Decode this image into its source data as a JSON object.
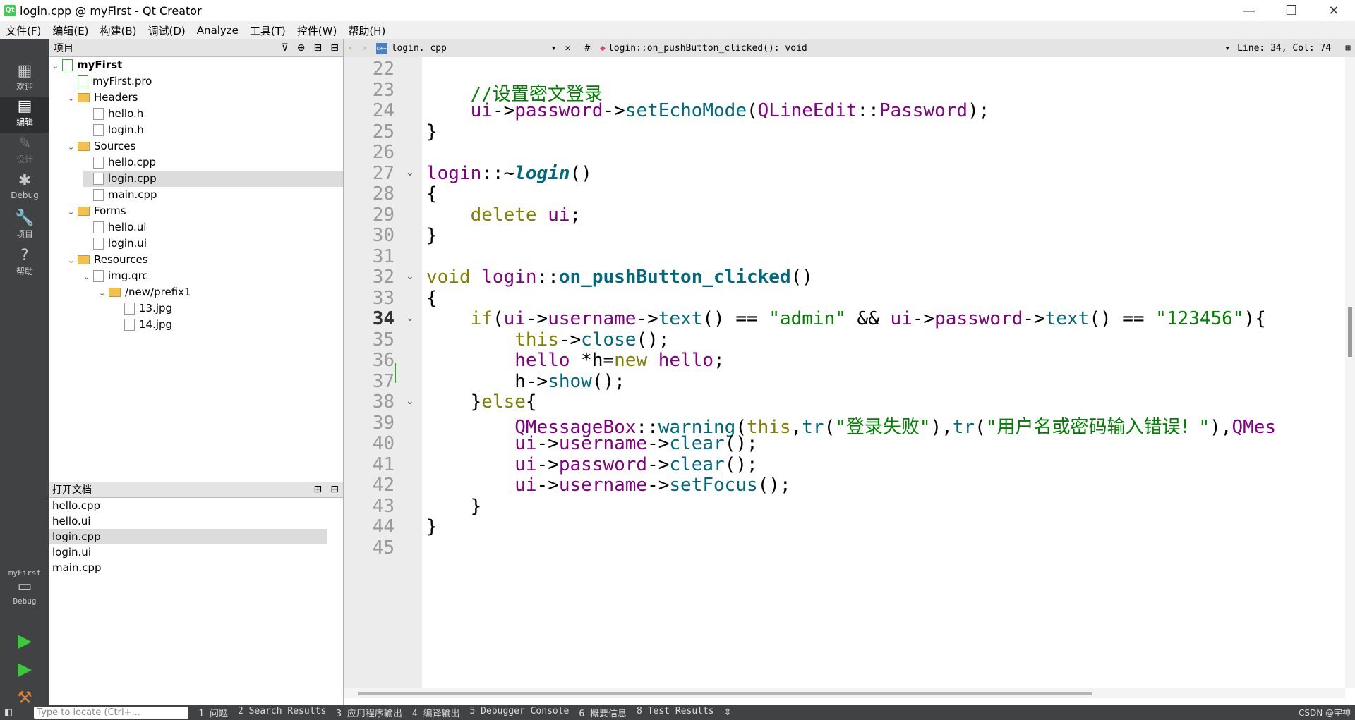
{
  "window": {
    "title": "login.cpp @ myFirst - Qt Creator",
    "minimize": "—",
    "restore": "❐",
    "close": "✕"
  },
  "menu": [
    "文件(F)",
    "编辑(E)",
    "构建(B)",
    "调试(D)",
    "Analyze",
    "工具(T)",
    "控件(W)",
    "帮助(H)"
  ],
  "modes": [
    {
      "label": "欢迎",
      "icon": "▦"
    },
    {
      "label": "编辑",
      "icon": "▤"
    },
    {
      "label": "设计",
      "icon": "✎"
    },
    {
      "label": "Debug",
      "icon": "✱"
    },
    {
      "label": "项目",
      "icon": "🔧"
    },
    {
      "label": "帮助",
      "icon": "?"
    }
  ],
  "kit": {
    "project": "myFirst",
    "config": "Debug"
  },
  "project_panel": {
    "title": "项目"
  },
  "tree": [
    {
      "label": "myFirst",
      "depth": 0,
      "arrow": "⌄",
      "kind": "proj"
    },
    {
      "label": "myFirst.pro",
      "depth": 1,
      "arrow": "",
      "kind": "proj"
    },
    {
      "label": "Headers",
      "depth": 1,
      "arrow": "⌄",
      "kind": "folder"
    },
    {
      "label": "hello.h",
      "depth": 2,
      "arrow": "",
      "kind": "h"
    },
    {
      "label": "login.h",
      "depth": 2,
      "arrow": "",
      "kind": "h"
    },
    {
      "label": "Sources",
      "depth": 1,
      "arrow": "⌄",
      "kind": "folder"
    },
    {
      "label": "hello.cpp",
      "depth": 2,
      "arrow": "",
      "kind": "cpp"
    },
    {
      "label": "login.cpp",
      "depth": 2,
      "arrow": "",
      "kind": "cpp",
      "selected": true
    },
    {
      "label": "main.cpp",
      "depth": 2,
      "arrow": "",
      "kind": "cpp"
    },
    {
      "label": "Forms",
      "depth": 1,
      "arrow": "⌄",
      "kind": "folder"
    },
    {
      "label": "hello.ui",
      "depth": 2,
      "arrow": "",
      "kind": "ui"
    },
    {
      "label": "login.ui",
      "depth": 2,
      "arrow": "",
      "kind": "ui"
    },
    {
      "label": "Resources",
      "depth": 1,
      "arrow": "⌄",
      "kind": "folder"
    },
    {
      "label": "img.qrc",
      "depth": 2,
      "arrow": "⌄",
      "kind": "qrc"
    },
    {
      "label": "/new/prefix1",
      "depth": 3,
      "arrow": "⌄",
      "kind": "folder"
    },
    {
      "label": "13.jpg",
      "depth": 4,
      "arrow": "",
      "kind": "img"
    },
    {
      "label": "14.jpg",
      "depth": 4,
      "arrow": "",
      "kind": "img"
    }
  ],
  "open_docs": {
    "title": "打开文档",
    "items": [
      "hello.cpp",
      "hello.ui",
      "login.cpp",
      "login.ui",
      "main.cpp"
    ],
    "selected": 2
  },
  "editor": {
    "file": "login. cpp",
    "hash": "#",
    "symbol": "login::on_pushButton_clicked(): void",
    "position": "Line: 34, Col: 74",
    "current_line": 34
  },
  "code_lines": [
    {
      "n": "22",
      "fold": "",
      "tokens": []
    },
    {
      "n": "23",
      "fold": "",
      "tokens": [
        [
          "",
          "    "
        ],
        [
          "cm",
          "//设置密文登录"
        ]
      ]
    },
    {
      "n": "24",
      "fold": "",
      "tokens": [
        [
          "",
          "    "
        ],
        [
          "ty",
          "ui"
        ],
        [
          "",
          "->"
        ],
        [
          "ty",
          "password"
        ],
        [
          "",
          "->"
        ],
        [
          "fn",
          "setEchoMode"
        ],
        [
          "",
          "("
        ],
        [
          "ty",
          "QLineEdit"
        ],
        [
          "",
          "::"
        ],
        [
          "ty",
          "Password"
        ],
        [
          "",
          ");"
        ]
      ]
    },
    {
      "n": "25",
      "fold": "",
      "tokens": [
        [
          "",
          "}"
        ]
      ]
    },
    {
      "n": "26",
      "fold": "",
      "tokens": []
    },
    {
      "n": "27",
      "fold": "⌄",
      "tokens": [
        [
          "ty",
          "login"
        ],
        [
          "",
          "::~"
        ],
        [
          "fni",
          "login"
        ],
        [
          "",
          "()"
        ]
      ]
    },
    {
      "n": "28",
      "fold": "",
      "tokens": [
        [
          "",
          "{"
        ]
      ]
    },
    {
      "n": "29",
      "fold": "",
      "tokens": [
        [
          "",
          "    "
        ],
        [
          "kw",
          "delete"
        ],
        [
          "",
          " "
        ],
        [
          "ty",
          "ui"
        ],
        [
          "",
          ";"
        ]
      ]
    },
    {
      "n": "30",
      "fold": "",
      "tokens": [
        [
          "",
          "}"
        ]
      ]
    },
    {
      "n": "31",
      "fold": "",
      "tokens": []
    },
    {
      "n": "32",
      "fold": "⌄",
      "tokens": [
        [
          "kw",
          "void"
        ],
        [
          "",
          " "
        ],
        [
          "ty",
          "login"
        ],
        [
          "",
          "::"
        ],
        [
          "fnb",
          "on_pushButton_clicked"
        ],
        [
          "",
          "()"
        ]
      ]
    },
    {
      "n": "33",
      "fold": "",
      "tokens": [
        [
          "",
          "{"
        ]
      ]
    },
    {
      "n": "34",
      "fold": "⌄",
      "tokens": [
        [
          "",
          "    "
        ],
        [
          "kw",
          "if"
        ],
        [
          "",
          "("
        ],
        [
          "ty",
          "ui"
        ],
        [
          "",
          "->"
        ],
        [
          "ty",
          "username"
        ],
        [
          "",
          "->"
        ],
        [
          "fn",
          "text"
        ],
        [
          "",
          "() == "
        ],
        [
          "str",
          "\"admin\""
        ],
        [
          "",
          " && "
        ],
        [
          "ty",
          "ui"
        ],
        [
          "",
          "->"
        ],
        [
          "ty",
          "password"
        ],
        [
          "",
          "->"
        ],
        [
          "fn",
          "text"
        ],
        [
          "",
          "() == "
        ],
        [
          "str",
          "\"123456\""
        ],
        [
          "",
          "){"
        ]
      ]
    },
    {
      "n": "35",
      "fold": "",
      "tokens": [
        [
          "",
          "        "
        ],
        [
          "kw",
          "this"
        ],
        [
          "",
          "->"
        ],
        [
          "fn",
          "close"
        ],
        [
          "",
          "();"
        ]
      ]
    },
    {
      "n": "36",
      "fold": "",
      "tokens": [
        [
          "",
          "        "
        ],
        [
          "ty",
          "hello"
        ],
        [
          "",
          " *"
        ],
        [
          "",
          "h"
        ],
        [
          "",
          "="
        ],
        [
          "kw",
          "new"
        ],
        [
          "",
          " "
        ],
        [
          "ty",
          "hello"
        ],
        [
          "",
          ";"
        ]
      ]
    },
    {
      "n": "37",
      "fold": "",
      "tokens": [
        [
          "",
          "        "
        ],
        [
          "",
          "h"
        ],
        [
          "",
          "->"
        ],
        [
          "fn",
          "show"
        ],
        [
          "",
          "();"
        ]
      ]
    },
    {
      "n": "38",
      "fold": "⌄",
      "tokens": [
        [
          "",
          "    }"
        ],
        [
          "kw",
          "else"
        ],
        [
          "",
          "{"
        ]
      ]
    },
    {
      "n": "39",
      "fold": "",
      "tokens": [
        [
          "",
          "        "
        ],
        [
          "ty",
          "QMessageBox"
        ],
        [
          "",
          "::"
        ],
        [
          "fn",
          "warning"
        ],
        [
          "",
          "("
        ],
        [
          "kw",
          "this"
        ],
        [
          "",
          ","
        ],
        [
          "fn",
          "tr"
        ],
        [
          "",
          "("
        ],
        [
          "str",
          "\"登录失败\""
        ],
        [
          "",
          "),"
        ],
        [
          "fn",
          "tr"
        ],
        [
          "",
          "("
        ],
        [
          "str",
          "\"用户名或密码输入错误！\""
        ],
        [
          "",
          "),"
        ],
        [
          "ty",
          "QMes"
        ]
      ]
    },
    {
      "n": "40",
      "fold": "",
      "tokens": [
        [
          "",
          "        "
        ],
        [
          "ty",
          "ui"
        ],
        [
          "",
          "->"
        ],
        [
          "ty",
          "username"
        ],
        [
          "",
          "->"
        ],
        [
          "fn",
          "clear"
        ],
        [
          "",
          "();"
        ]
      ]
    },
    {
      "n": "41",
      "fold": "",
      "tokens": [
        [
          "",
          "        "
        ],
        [
          "ty",
          "ui"
        ],
        [
          "",
          "->"
        ],
        [
          "ty",
          "password"
        ],
        [
          "",
          "->"
        ],
        [
          "fn",
          "clear"
        ],
        [
          "",
          "();"
        ]
      ]
    },
    {
      "n": "42",
      "fold": "",
      "tokens": [
        [
          "",
          "        "
        ],
        [
          "ty",
          "ui"
        ],
        [
          "",
          "->"
        ],
        [
          "ty",
          "username"
        ],
        [
          "",
          "->"
        ],
        [
          "fn",
          "setFocus"
        ],
        [
          "",
          "();"
        ]
      ]
    },
    {
      "n": "43",
      "fold": "",
      "tokens": [
        [
          "",
          "    }"
        ]
      ]
    },
    {
      "n": "44",
      "fold": "",
      "tokens": [
        [
          "",
          "}"
        ]
      ]
    },
    {
      "n": "45",
      "fold": "",
      "tokens": []
    }
  ],
  "status": {
    "locate_placeholder": "Type to locate (Ctrl+...",
    "tabs": [
      "1 问题",
      "2 Search Results",
      "3 应用程序输出",
      "4 编译输出",
      "5 Debugger Console",
      "6 概要信息",
      "8 Test Results"
    ],
    "watermark": "CSDN @宇神"
  },
  "colors": {
    "keyword": "#808000",
    "type": "#800080",
    "function": "#00677c",
    "string": "#008000",
    "sidebar": "#404244"
  }
}
